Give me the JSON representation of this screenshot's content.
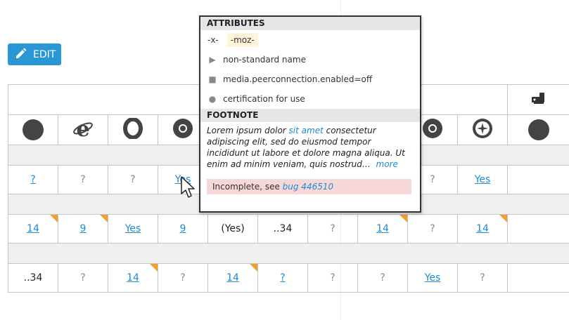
{
  "toolbar": {
    "edit_label": "EDIT"
  },
  "rows": {
    "r1": [
      "?",
      "?",
      "?",
      "Yes",
      "",
      "",
      "",
      "",
      "?",
      "Yes",
      ""
    ],
    "r2": [
      "14",
      "9",
      "Yes",
      "9",
      "(Yes)",
      "..34",
      "?",
      "14",
      "?",
      "14",
      ""
    ],
    "r3": [
      "..34",
      "?",
      "14",
      "?",
      "14",
      "?",
      "?",
      "?",
      "Yes",
      "?",
      ""
    ]
  },
  "popup": {
    "attributes_heading": "ATTRIBUTES",
    "prefix_x": "-x-",
    "prefix_moz": "-moz-",
    "nonstandard": "non-standard name",
    "pref": "media.peerconnection.enabled=off",
    "certification": "certification for use",
    "footnote_heading": "FOOTNOTE",
    "footnote_text_1": "Lorem ipsum dolor ",
    "footnote_link": "sit amet",
    "footnote_text_2": " consectetur adipiscing elit, sed do eiusmod tempor incididunt ut labore et dolore magna aliqua. Ut enim ad minim veniam, quis nostrud…",
    "more_label": "more",
    "incomplete_text": "Incomplete, see ",
    "bug_link": "bug 446510"
  },
  "colors": {
    "accent": "#2996d6",
    "link": "#1e8ad4",
    "flag": "#f0a030",
    "incomplete_bg": "#f7d8d8"
  }
}
